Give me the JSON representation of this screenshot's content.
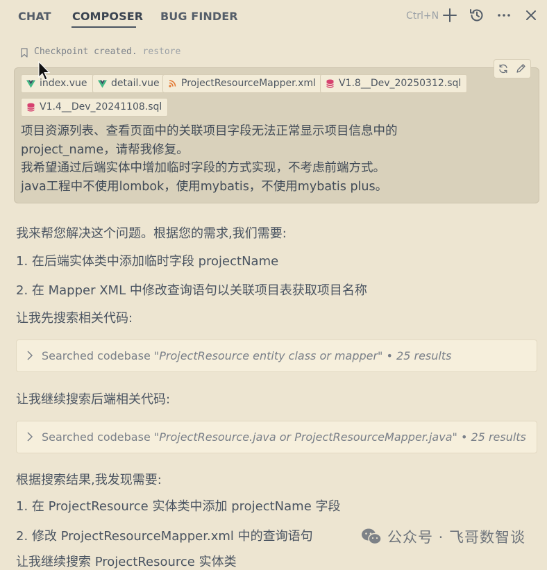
{
  "tabs": [
    {
      "label": "CHAT"
    },
    {
      "label": "COMPOSER"
    },
    {
      "label": "BUG FINDER"
    }
  ],
  "toolbar": {
    "shortcut": "Ctrl+N"
  },
  "checkpoint": {
    "text": "Checkpoint created.",
    "restore": "restore"
  },
  "attachments": [
    {
      "label": "index.vue",
      "icon": "vue-icon"
    },
    {
      "label": "detail.vue",
      "icon": "vue-icon"
    },
    {
      "label": "ProjectResourceMapper.xml",
      "icon": "rss-icon"
    },
    {
      "label": "V1.8__Dev_20250312.sql",
      "icon": "database-icon"
    },
    {
      "label": "V1.4__Dev_20241108.sql",
      "icon": "database-icon"
    }
  ],
  "user_message": {
    "lines": [
      "项目资源列表、查看页面中的关联项目字段无法正常显示项目信息中的",
      "project_name，请帮我修复。",
      "我希望通过后端实体中增加临时字段的方式实现，不考虑前端方式。",
      "java工程中不使用lombok，使用mybatis，不使用mybatis plus。"
    ]
  },
  "assistant": {
    "intro": "我来帮您解决这个问题。根据您的需求,我们需要:",
    "step1": "1. 在后端实体类中添加临时字段 projectName",
    "step2": "2. 在 Mapper XML 中修改查询语句以关联项目表获取项目名称",
    "search_first": "让我先搜索相关代码:",
    "search1": {
      "prefix": "Searched codebase",
      "query": "\"ProjectResource entity class or mapper\"",
      "results": "• 25 results"
    },
    "search_continue": "让我继续搜索后端相关代码:",
    "search2": {
      "prefix": "Searched codebase",
      "query": "\"ProjectResource.java or ProjectResourceMapper.java\"",
      "results": "• 25 results"
    },
    "found": "根据搜索结果,我发现需要:",
    "fix1": "1. 在 ProjectResource 实体类中添加 projectName 字段",
    "fix2": "2. 修改 ProjectResourceMapper.xml 中的查询语句",
    "partial": "让我继续搜索 ProjectResource 实体类"
  },
  "watermark": {
    "text": "公众号 · 飞哥数智谈"
  },
  "colors": {
    "background": "#ede5d1",
    "message_box": "#d9d1bb",
    "chip": "#f3ecd8",
    "vue_green": "#41b883",
    "sql_pink": "#d6416f",
    "xml_orange": "#e37933"
  }
}
